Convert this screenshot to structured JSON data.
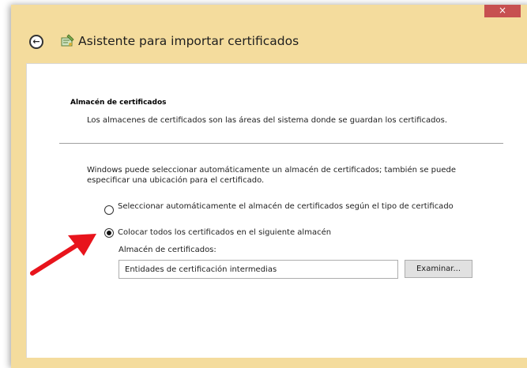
{
  "window": {
    "close_glyph": "×",
    "title": "Asistente para importar certificados",
    "icons": {
      "back": "back-arrow-icon",
      "wizard": "certificate-wizard-icon"
    }
  },
  "section": {
    "title": "Almacén de certificados",
    "description": "Los almacenes de certificados son las áreas del sistema donde se guardan los certificados."
  },
  "body": {
    "intro": "Windows puede seleccionar automáticamente un almacén de certificados; también se puede especificar una ubicación para el certificado.",
    "options": [
      {
        "label": "Seleccionar automáticamente el almacén de certificados según el tipo de certificado",
        "selected": false
      },
      {
        "label": "Colocar todos los certificados en el siguiente almacén",
        "selected": true
      }
    ],
    "store_label": "Almacén de certificados:",
    "store_value": "Entidades de certificación intermedias",
    "browse_label": "Examinar..."
  },
  "colors": {
    "window_frame": "#f4dc9d",
    "close_button": "#c75050",
    "annotation_arrow": "#e8141c"
  }
}
